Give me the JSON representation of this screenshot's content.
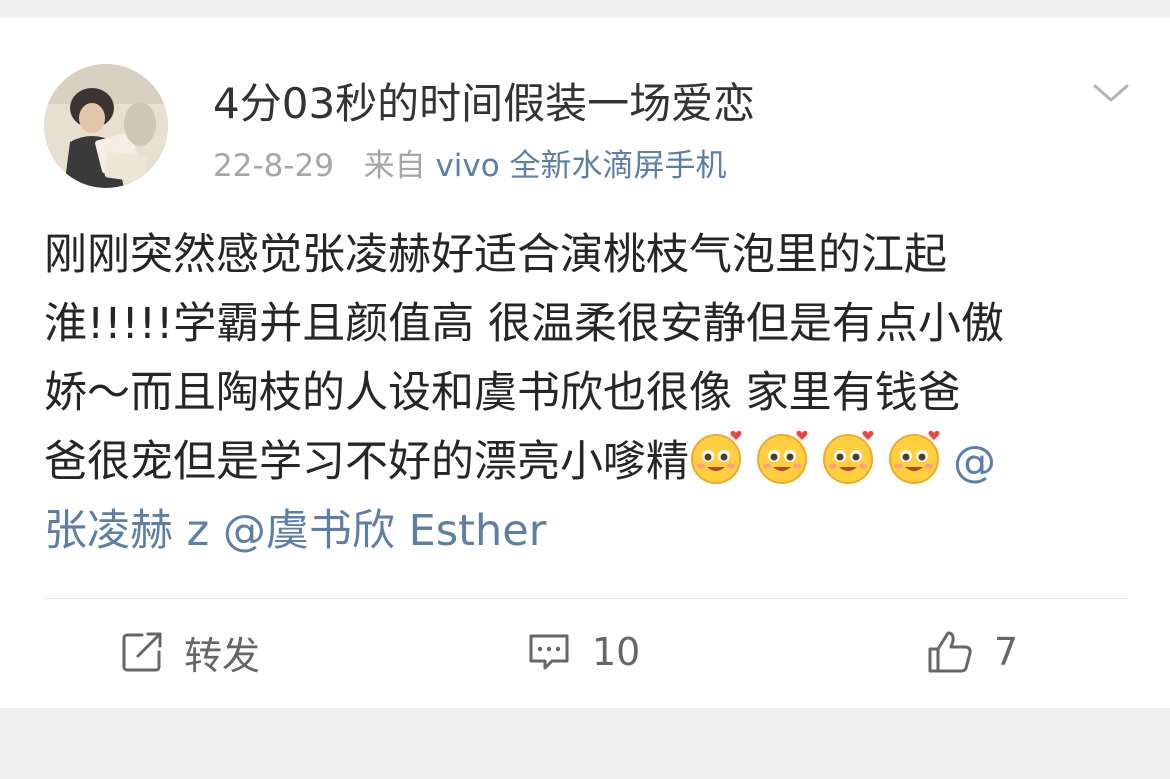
{
  "post": {
    "author": "4分03秒的时间假装一场爱恋",
    "date": "22-8-29",
    "source_prefix": "来自",
    "device": "vivo 全新水滴屏手机",
    "text_lines": [
      "刚刚突然感觉张凌赫好适合演桃枝气泡里的江起",
      "淮!!!!!学霸并且颜值高 很温柔很安静但是有点小傲",
      "娇～而且陶枝的人设和虞书欣也很像 家里有钱爸",
      "爸很宠但是学习不好的漂亮小嗲精"
    ],
    "mention_at": "@",
    "mention_1": "张凌赫 z",
    "mention_2": "@虞书欣 Esther",
    "emojis": [
      "heart-eyes-face",
      "heart-eyes-face",
      "heart-eyes-face",
      "heart-eyes-face"
    ]
  },
  "actions": {
    "repost_label": "转发",
    "comment_count": "10",
    "like_count": "7"
  },
  "icons": {
    "menu": "chevron-down-icon",
    "repost": "share-icon",
    "comment": "comment-icon",
    "like": "thumbs-up-icon"
  },
  "colors": {
    "link": "#5d7fa6",
    "text": "#262626",
    "meta": "#a6a6a6",
    "background_strip": "#f0f0f0"
  }
}
